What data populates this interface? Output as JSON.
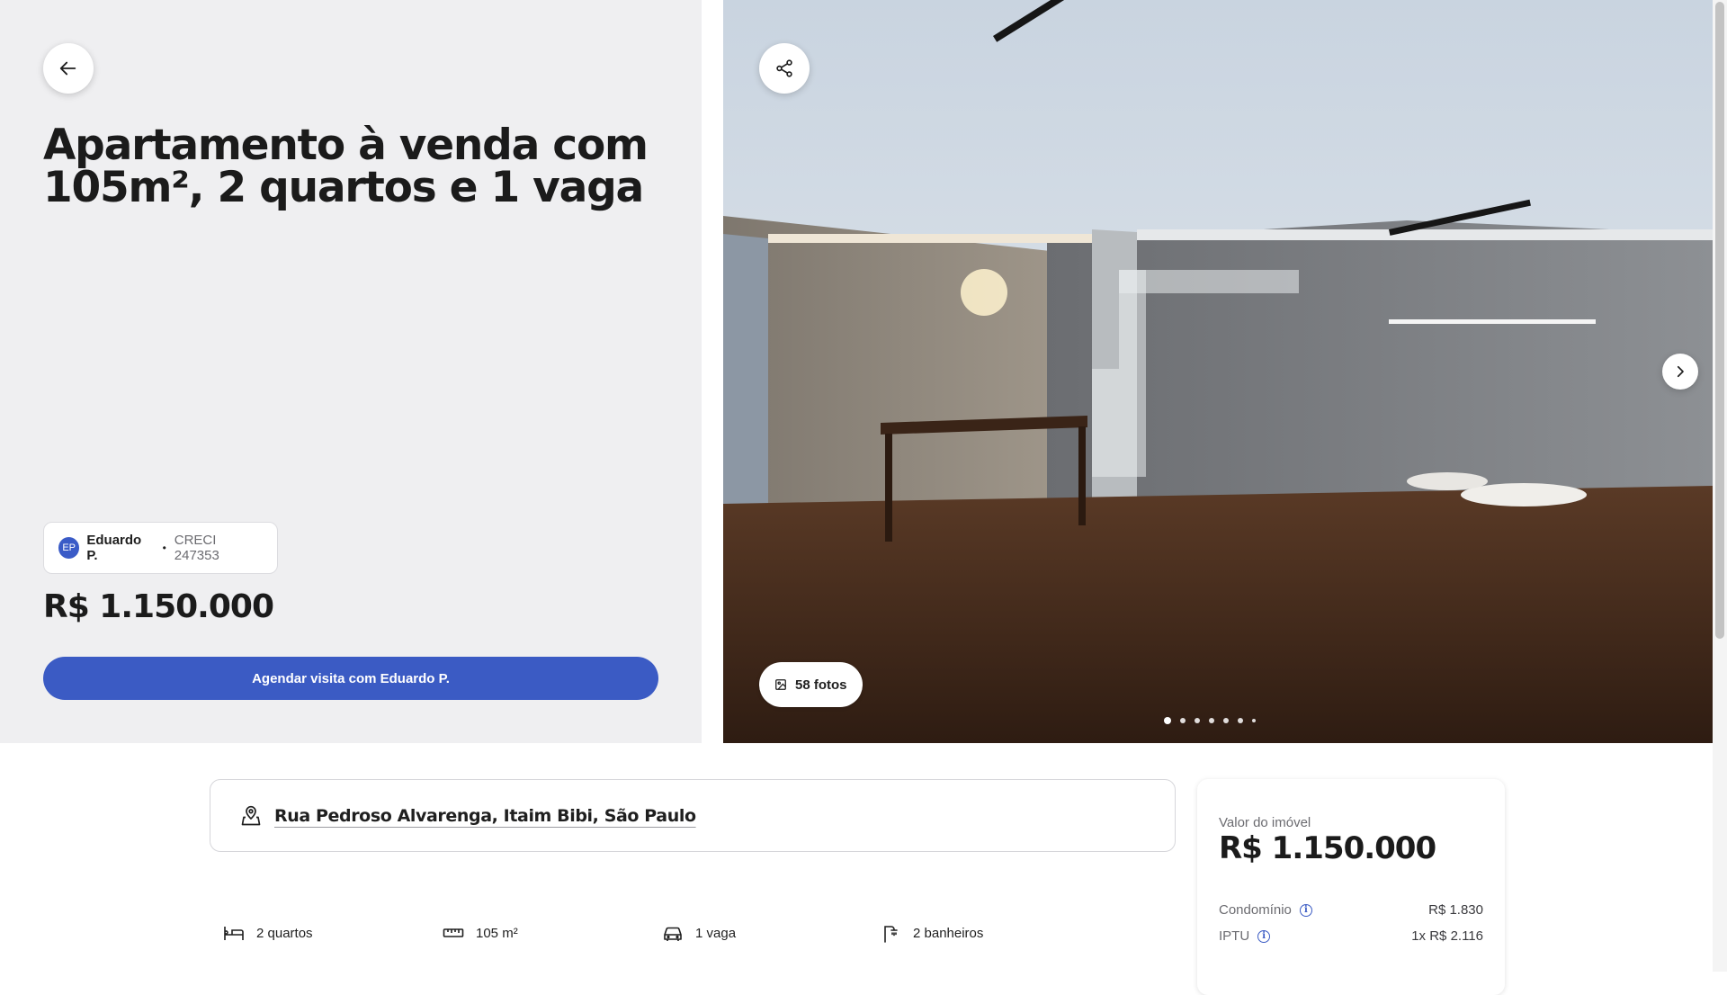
{
  "listing": {
    "title": "Apartamento à venda com 105m², 2 quartos e 1 vaga",
    "price": "R$ 1.150.000",
    "cta_label": "Agendar visita com Eduardo P."
  },
  "agent": {
    "initials": "EP",
    "name": "Eduardo P.",
    "separator": "•",
    "creci": "CRECI 247353"
  },
  "gallery": {
    "photos_label": "58 fotos",
    "dot_count": 7,
    "active_dot": 0
  },
  "address": {
    "text": "Rua Pedroso Alvarenga, Itaim Bibi, São Paulo",
    "icon": "map-pin-icon"
  },
  "features": [
    {
      "icon": "bed-icon",
      "label": "2 quartos"
    },
    {
      "icon": "ruler-icon",
      "label": "105 m²"
    },
    {
      "icon": "car-icon",
      "label": "1 vaga"
    },
    {
      "icon": "shower-icon",
      "label": "2 banheiros"
    }
  ],
  "value_card": {
    "label": "Valor do imóvel",
    "price": "R$ 1.150.000",
    "fees": [
      {
        "label": "Condomínio",
        "amount": "R$ 1.830"
      },
      {
        "label": "IPTU",
        "amount": "1x R$ 2.116"
      }
    ]
  },
  "icons": {
    "back": "arrow-left-icon",
    "share": "share-icon",
    "next": "chevron-right-icon",
    "photos": "image-icon",
    "info": "info-icon"
  },
  "colors": {
    "accent": "#3b5bc4",
    "panel": "#efeff1"
  }
}
